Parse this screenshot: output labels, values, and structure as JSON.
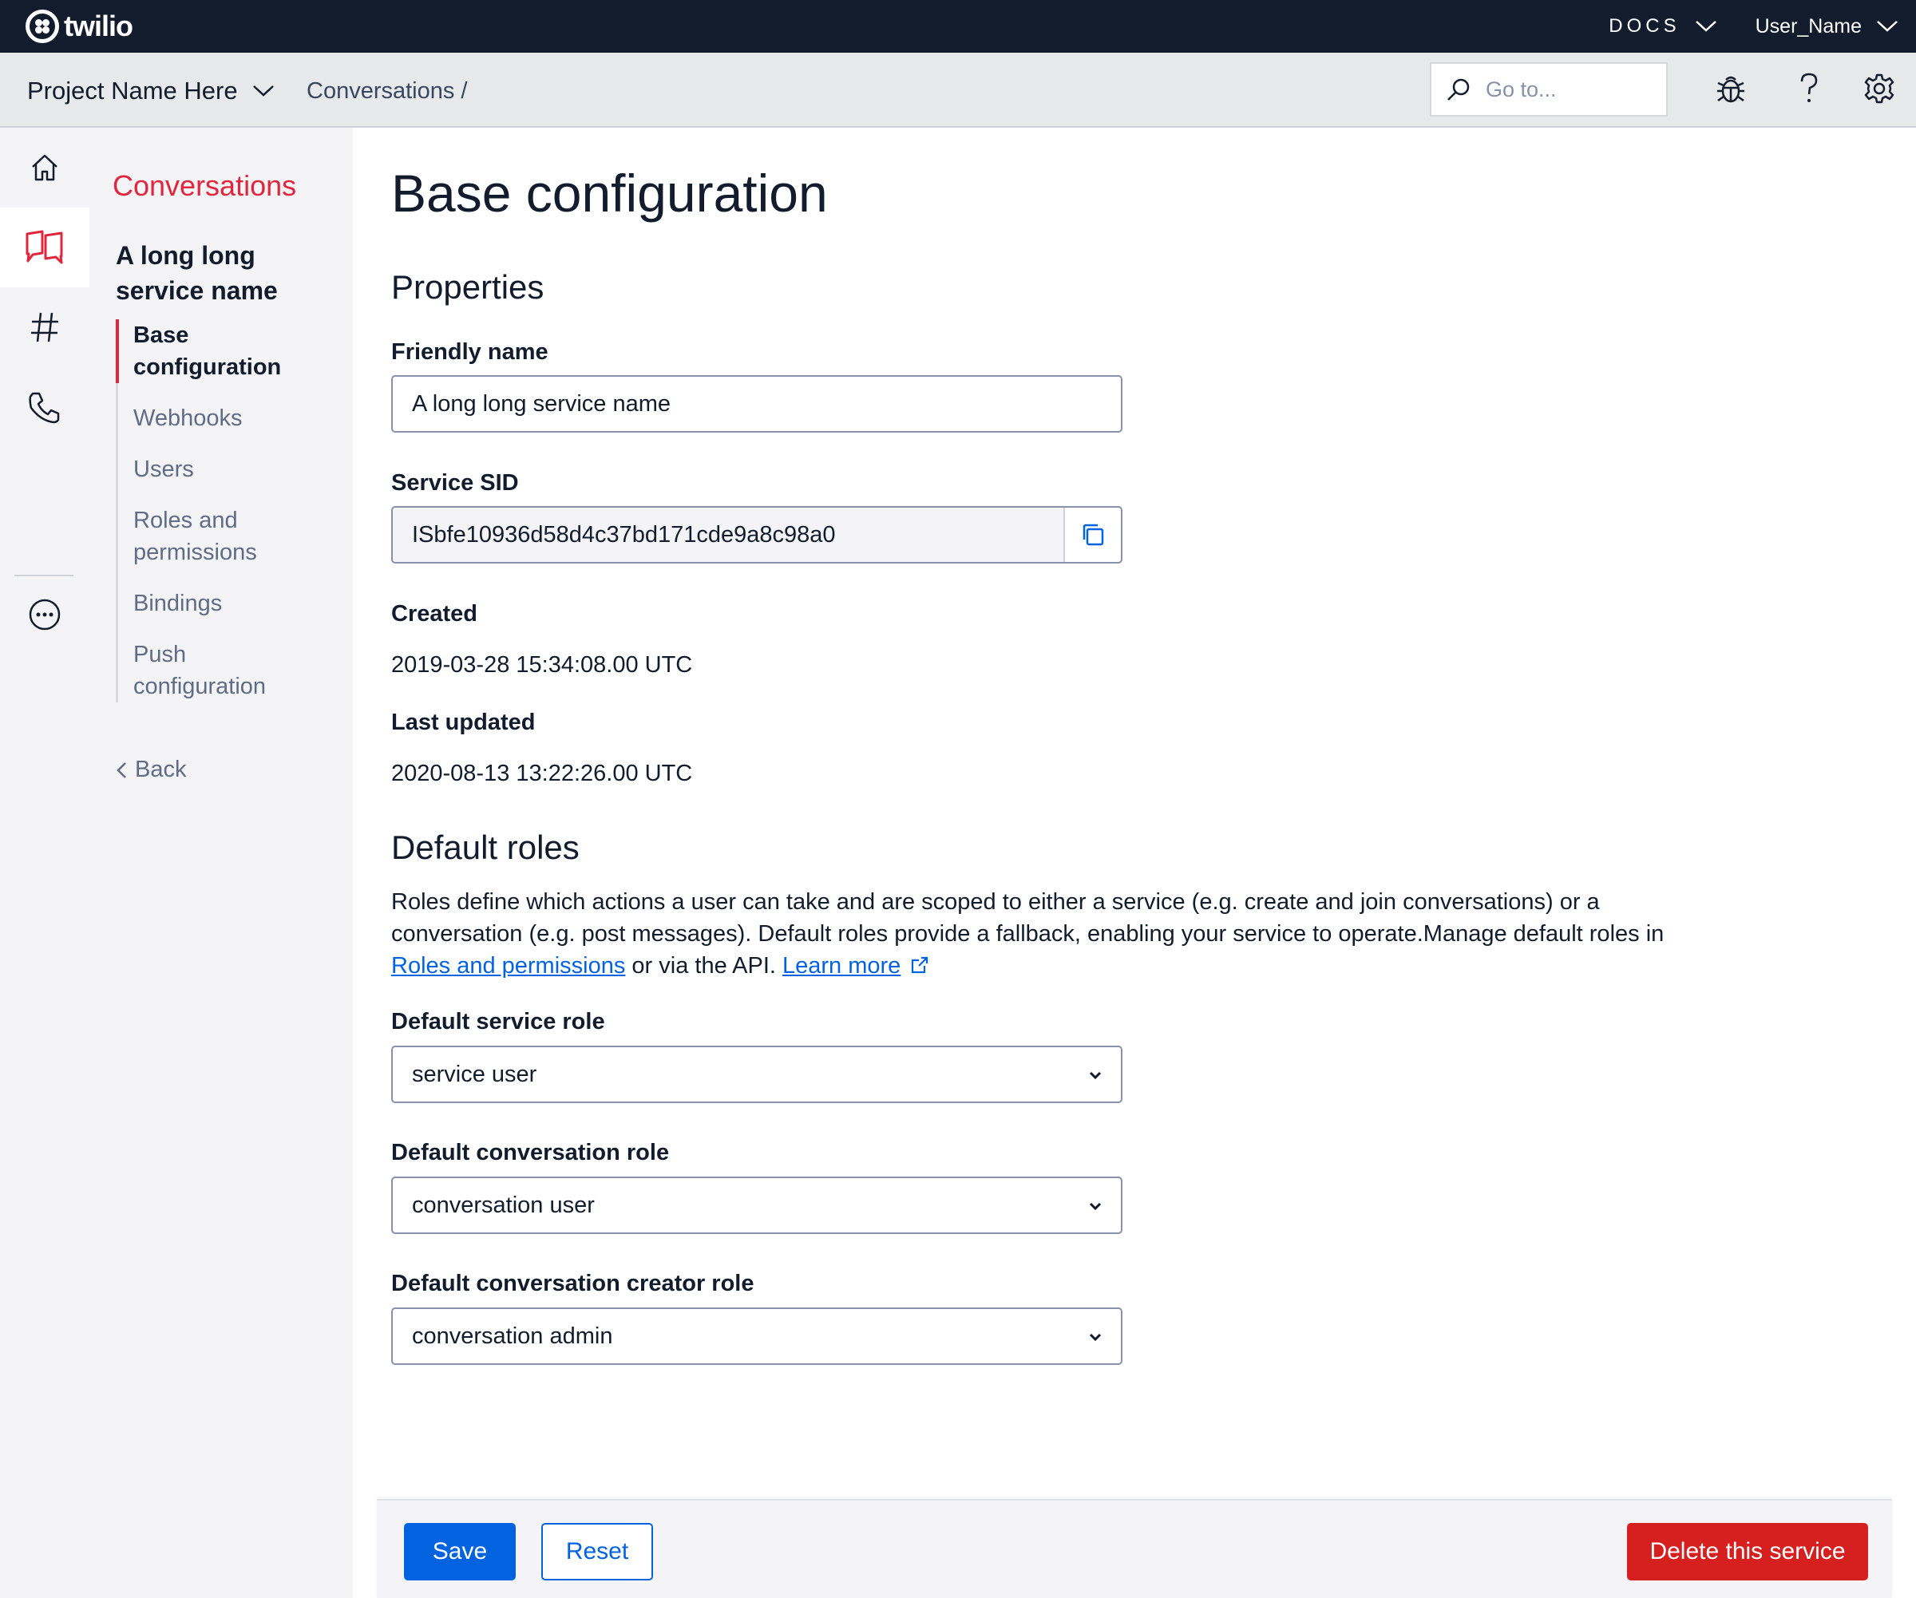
{
  "topbar": {
    "logo_text": "twilio",
    "docs_label": "DOCS",
    "user_label": "User_Name"
  },
  "subbar": {
    "project_name": "Project Name Here",
    "breadcrumb": "Conversations /",
    "search_placeholder": "Go to..."
  },
  "rail": {
    "items": [
      "home-icon",
      "conversations-icon",
      "hash-icon",
      "phone-icon",
      "more-icon"
    ],
    "active": "conversations-icon"
  },
  "subnav": {
    "title": "Conversations",
    "service_name": "A long long service name",
    "items": [
      {
        "label": "Base configuration"
      },
      {
        "label": "Webhooks"
      },
      {
        "label": "Users"
      },
      {
        "label": "Roles and permissions"
      },
      {
        "label": "Bindings"
      },
      {
        "label": "Push configuration"
      }
    ],
    "back_label": "Back"
  },
  "main": {
    "title": "Base configuration",
    "properties_heading": "Properties",
    "friendly_name_label": "Friendly name",
    "friendly_name_value": "A long long service name",
    "service_sid_label": "Service SID",
    "service_sid_value": "ISbfe10936d58d4c37bd171cde9a8c98a0",
    "created_label": "Created",
    "created_value": "2019-03-28 15:34:08.00 UTC",
    "last_updated_label": "Last updated",
    "last_updated_value": "2020-08-13 13:22:26.00 UTC",
    "default_roles_heading": "Default roles",
    "roles_text_1": "Roles define which actions a user can take and are scoped to either a service (e.g. create and join conversations) or a conversation (e.g. post messages). Default roles provide a fallback, enabling your service to operate.Manage default roles in ",
    "roles_link": "Roles and permissions",
    "roles_text_2": " or via the API. ",
    "learn_more": "Learn more",
    "service_role_label": "Default service role",
    "service_role_value": "service user",
    "conversation_role_label": "Default conversation role",
    "conversation_role_value": "conversation user",
    "creator_role_label": "Default conversation creator role",
    "creator_role_value": "conversation admin"
  },
  "actions": {
    "save_label": "Save",
    "reset_label": "Reset",
    "delete_label": "Delete this service"
  },
  "colors": {
    "brand_red": "#e0263d",
    "primary_blue": "#0263e0",
    "destructive_red": "#d61f1f",
    "topbar_bg": "#121c2d"
  }
}
